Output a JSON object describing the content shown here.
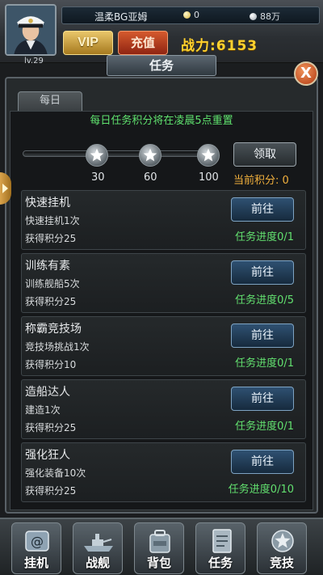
{
  "header": {
    "player_name": "温柔BG亚姆",
    "level": "lv.29",
    "gems": "0",
    "coins": "88万",
    "vip_label": "VIP",
    "recharge_label": "充值",
    "power_label": "战力:6153",
    "avatar_icon": "officer-portrait-icon",
    "gem_icon": "gem-icon",
    "coin_icon": "coin-icon"
  },
  "window": {
    "title": "任务",
    "close_icon": "close-icon",
    "close_label": "X",
    "tab_daily": "每日"
  },
  "daily": {
    "reset_note": "每日任务积分将在凌晨5点重置",
    "progress_fraction": 0,
    "milestones": [
      {
        "value": "30",
        "icon": "star-badge-icon"
      },
      {
        "value": "60",
        "icon": "star-badge-icon"
      },
      {
        "value": "100",
        "icon": "star-badge-icon"
      }
    ],
    "claim_label": "领取",
    "current_points": "当前积分: 0"
  },
  "tasks": [
    {
      "title": "快速挂机",
      "desc": "快速挂机1次",
      "points": "获得积分25",
      "button": "前往",
      "progress": "任务进度0/1"
    },
    {
      "title": "训练有素",
      "desc": "训练舰船5次",
      "points": "获得积分25",
      "button": "前往",
      "progress": "任务进度0/5"
    },
    {
      "title": "称霸竞技场",
      "desc": "竞技场挑战1次",
      "points": "获得积分10",
      "button": "前往",
      "progress": "任务进度0/1"
    },
    {
      "title": "造船达人",
      "desc": "建造1次",
      "points": "获得积分25",
      "button": "前往",
      "progress": "任务进度0/1"
    },
    {
      "title": "强化狂人",
      "desc": "强化装备10次",
      "points": "获得积分25",
      "button": "前往",
      "progress": "任务进度0/10"
    }
  ],
  "nav": [
    {
      "label": "挂机",
      "icon": "idle-mail-icon"
    },
    {
      "label": "战舰",
      "icon": "warship-icon"
    },
    {
      "label": "背包",
      "icon": "backpack-icon"
    },
    {
      "label": "任务",
      "icon": "task-list-icon"
    },
    {
      "label": "竞技",
      "icon": "arena-emblem-icon"
    }
  ],
  "colors": {
    "accent_green": "#5fe26e",
    "power_yellow": "#ffd22e",
    "points_orange": "#f2b13d",
    "button_blue": "#2f5172"
  }
}
